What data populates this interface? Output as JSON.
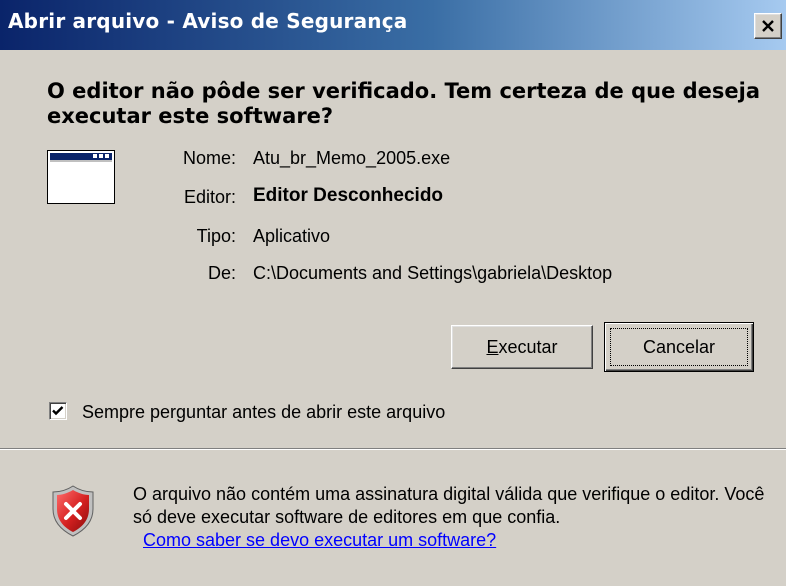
{
  "window": {
    "title": "Abrir arquivo - Aviso de Segurança",
    "close_icon": "close-icon"
  },
  "question": "O editor não pôde ser verificado.  Tem certeza de que deseja executar este software?",
  "details": {
    "name_label": "Nome:",
    "name_value": "Atu_br_Memo_2005.exe",
    "publisher_label": "Editor:",
    "publisher_value": "Editor Desconhecido",
    "type_label": "Tipo:",
    "type_value": "Aplicativo",
    "from_label": "De:",
    "from_value": "C:\\Documents and Settings\\gabriela\\Desktop"
  },
  "buttons": {
    "run_mnemonic": "E",
    "run_rest": "xecutar",
    "cancel_label": "Cancelar"
  },
  "checkbox": {
    "checked": true,
    "label": "Sempre perguntar antes de abrir este arquivo"
  },
  "warning": {
    "text": "O arquivo não contém uma assinatura digital válida que verifique o editor.  Você só deve executar software de editores em que confia.",
    "link": "Como saber se devo executar um software?",
    "icon": "shield-warning-icon"
  },
  "colors": {
    "titlebar_start": "#0a246a",
    "titlebar_end": "#a6caf0",
    "dialog_bg": "#d4d0c8",
    "link": "#0000ff",
    "shield_red": "#d42020"
  }
}
